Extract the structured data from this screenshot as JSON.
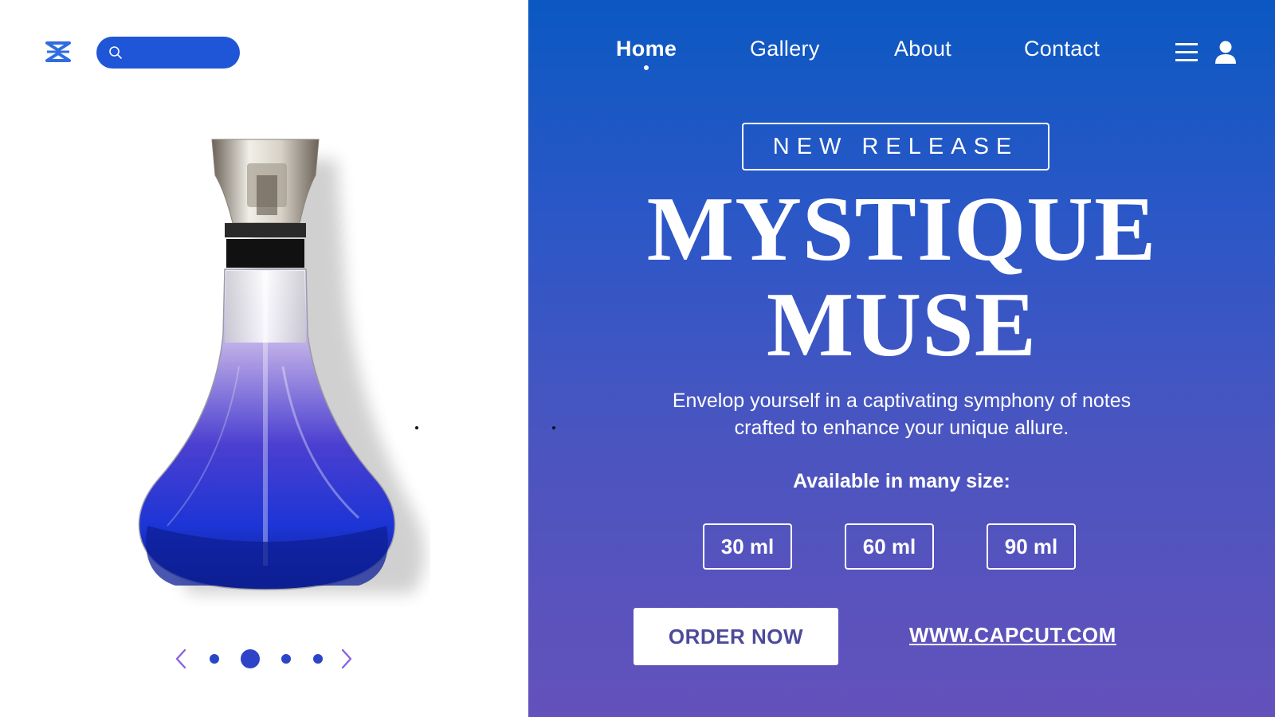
{
  "brand": {
    "logo_icon": "capcut-logo-icon",
    "color": "#2f6de0"
  },
  "search": {
    "placeholder": "",
    "icon": "search-icon"
  },
  "product_image": {
    "icon": "perfume-bottle-illustration"
  },
  "carousel": {
    "total": 4,
    "active_index": 1,
    "prev_icon": "chevron-left-icon",
    "next_icon": "chevron-right-icon"
  },
  "nav": {
    "items": [
      {
        "label": "Home",
        "active": true
      },
      {
        "label": "Gallery",
        "active": false
      },
      {
        "label": "About",
        "active": false
      },
      {
        "label": "Contact",
        "active": false
      }
    ],
    "menu_icon": "hamburger-menu-icon",
    "user_icon": "user-icon"
  },
  "hero": {
    "badge": "NEW RELEASE",
    "title_line1": "MYSTIQUE",
    "title_line2": "MUSE",
    "description_line1": "Envelop yourself in a captivating symphony of notes",
    "description_line2": "crafted to enhance your unique allure.",
    "sizes_label": "Available in many size:",
    "sizes": [
      "30 ml",
      "60 ml",
      "90 ml"
    ],
    "cta": "ORDER NOW",
    "website": "WWW.CAPCUT.COM"
  },
  "colors": {
    "accent_blue": "#1f56d8",
    "gradient_top": "#0b58c2",
    "gradient_bottom": "#6451bb",
    "cta_text": "#4d4a9a",
    "carousel_arrow": "#8a63e0"
  }
}
